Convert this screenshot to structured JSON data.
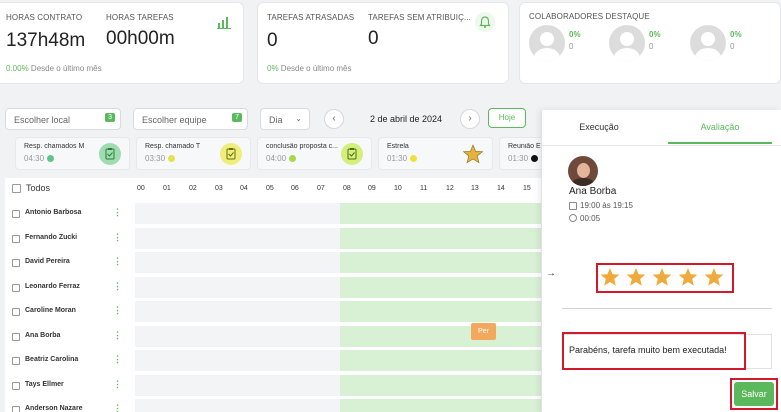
{
  "kpis": {
    "horas_contrato": {
      "label": "HORAS CONTRATO",
      "value": "137h48m"
    },
    "horas_tarefas": {
      "label": "HORAS TAREFAS",
      "value": "00h00m"
    },
    "foot1_pct": "0.00%",
    "foot1_text": "Desde o último mês",
    "tarefas_atrasadas": {
      "label": "TAREFAS ATRASADAS",
      "value": "0"
    },
    "tarefas_sem": {
      "label": "TAREFAS SEM ATRIBUIÇ...",
      "value": "0"
    },
    "foot2_pct": "0%",
    "foot2_text": "Desde o último mês",
    "colaboradores": {
      "label": "COLABORADORES DESTAQUE",
      "items": [
        {
          "pct": "0%",
          "num": "0"
        },
        {
          "pct": "0%",
          "num": "0"
        },
        {
          "pct": "0%",
          "num": "0"
        }
      ]
    }
  },
  "filters": {
    "local": {
      "label": "Escolher local",
      "badge": "3"
    },
    "equipe": {
      "label": "Escolher equipe",
      "badge": "7"
    },
    "period": "Dia",
    "date": "2 de abril de 2024",
    "today": "Hoje"
  },
  "tasks": [
    {
      "name": "Resp. chamados M",
      "time": "04:30",
      "dot": "#5fc48a"
    },
    {
      "name": "Resp. chamado T",
      "time": "03:30",
      "dot": "#e4e14b"
    },
    {
      "name": "conclusão proposta c...",
      "time": "04:00",
      "dot": "#a8d84a"
    },
    {
      "name": "Estrela",
      "time": "01:30",
      "dot": "#f2e03a"
    },
    {
      "name": "Reunião Eq",
      "time": "01:30",
      "dot": "#111111"
    }
  ],
  "grid": {
    "all_label": "Todos",
    "hours": [
      "00",
      "01",
      "02",
      "03",
      "04",
      "05",
      "06",
      "07",
      "08",
      "09",
      "10",
      "11",
      "12",
      "13",
      "14",
      "15"
    ],
    "people": [
      "Antonio Barbosa",
      "Fernando Zucki",
      "David Pereira",
      "Leonardo Ferraz",
      "Caroline Moran",
      "Ana Borba",
      "Beatriz Carolina",
      "Tays Ellmer",
      "Anderson Nazare"
    ],
    "event_label": "Per"
  },
  "panel": {
    "tab_exec": "Execução",
    "tab_eval": "Avaliação",
    "name": "Ana Borba",
    "schedule": "19:00 às 19:15",
    "duration": "00:05",
    "rating": 5,
    "comment": "Parabéns, tarefa muito bem executada!",
    "save": "Salvar",
    "collapse_icon": "→"
  },
  "colors": {
    "accent": "#5cb85c",
    "highlight": "#d0192a",
    "star": "#f0a93b"
  }
}
